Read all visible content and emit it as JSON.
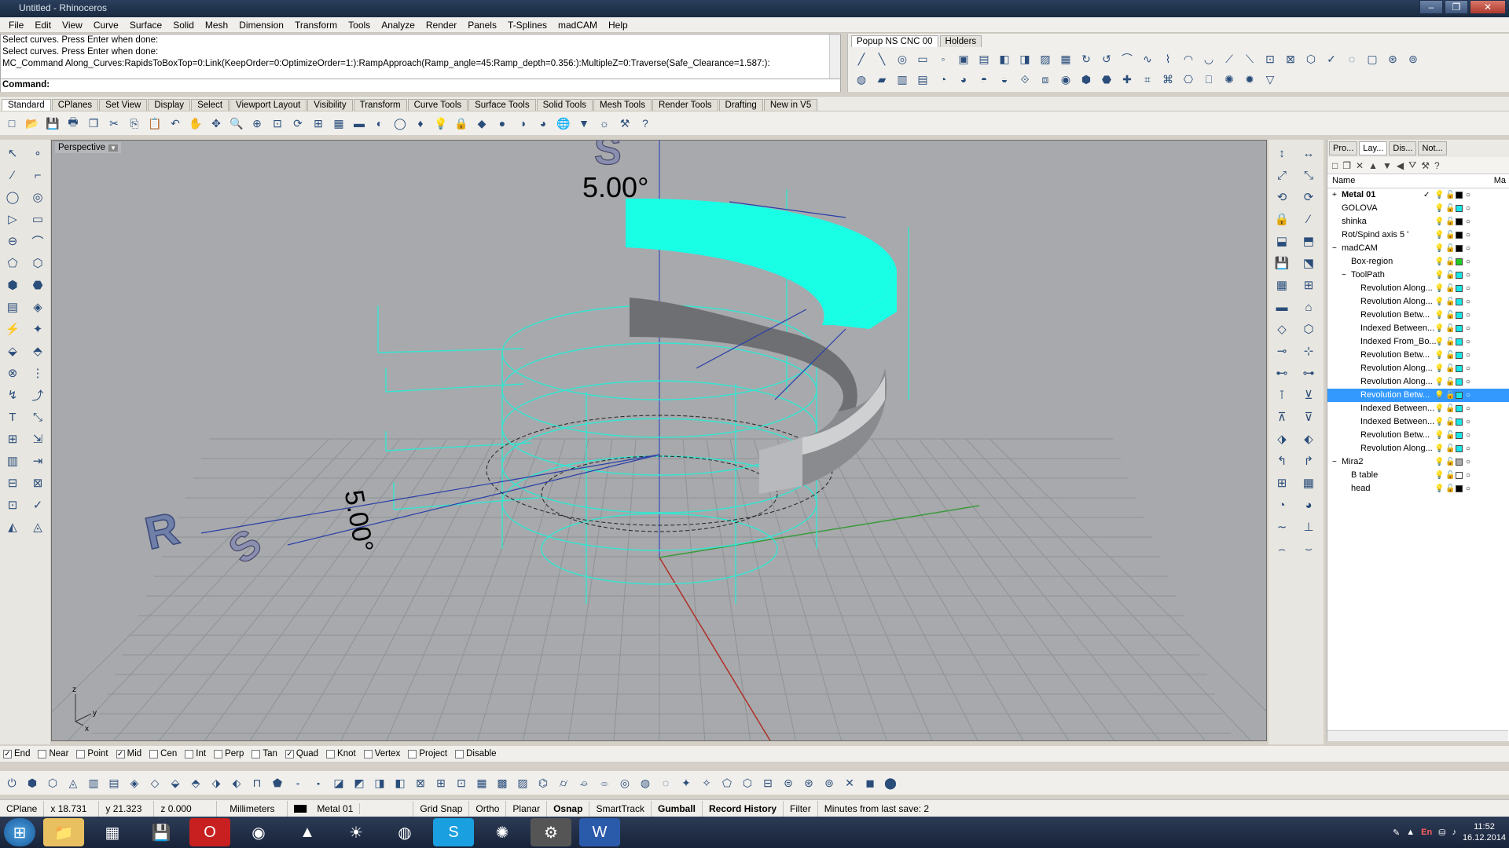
{
  "window": {
    "title": "Untitled - Rhinoceros",
    "buttons": [
      "–",
      "❐",
      "✕"
    ]
  },
  "menu": [
    "File",
    "Edit",
    "View",
    "Curve",
    "Surface",
    "Solid",
    "Mesh",
    "Dimension",
    "Transform",
    "Tools",
    "Analyze",
    "Render",
    "Panels",
    "T-Splines",
    "madCAM",
    "Help"
  ],
  "command": {
    "history": [
      "Select curves. Press Enter when done:",
      "Select curves. Press Enter when done:",
      "MC_Command Along_Curves:RapidsToBoxTop=0:Link(KeepOrder=0:OptimizeOrder=1:):RampApproach(Ramp_angle=45:Ramp_depth=0.356:):MultipleZ=0:Traverse(Safe_Clearance=1.587:):"
    ],
    "prompt": "Command:"
  },
  "popup_tabs": [
    "Popup NS CNC 00",
    "Holders"
  ],
  "toolbar_tabs": [
    "Standard",
    "CPlanes",
    "Set View",
    "Display",
    "Select",
    "Viewport Layout",
    "Visibility",
    "Transform",
    "Curve Tools",
    "Surface Tools",
    "Solid Tools",
    "Mesh Tools",
    "Render Tools",
    "Drafting",
    "New in V5"
  ],
  "viewport": {
    "label": "Perspective",
    "dim_top": "5.00°",
    "dim_bottom": "5.00°",
    "letter_r": "R",
    "letter_s": "S",
    "axis_x": "x",
    "axis_y": "y",
    "axis_z": "z",
    "colors": {
      "background": "#a7a9ac",
      "toolpath": "#33e6d2",
      "cyan_surface": "#19ffe6",
      "x_axis": "#b0302a",
      "y_axis": "#3a9a3a"
    }
  },
  "layer_panel": {
    "tabs": [
      "Pro...",
      "Lay...",
      "Dis...",
      "Not..."
    ],
    "column_name": "Name",
    "column_mat": "Ma",
    "layers": [
      {
        "name": "Metal 01",
        "indent": 0,
        "expand": "+",
        "bold": true,
        "current": "✓",
        "color": "#000000"
      },
      {
        "name": "GOLOVA",
        "indent": 0,
        "expand": "",
        "color": "#19e6e6"
      },
      {
        "name": "shinka",
        "indent": 0,
        "expand": "",
        "color": "#000000"
      },
      {
        "name": "Rot/Spind  axis 5 '",
        "indent": 0,
        "expand": "",
        "color": "#000000"
      },
      {
        "name": "madCAM",
        "indent": 0,
        "expand": "−",
        "color": "#000000"
      },
      {
        "name": "Box-region",
        "indent": 1,
        "expand": "",
        "color": "#22cc22"
      },
      {
        "name": "ToolPath",
        "indent": 1,
        "expand": "−",
        "color": "#19e6e6"
      },
      {
        "name": "Revolution Along...",
        "indent": 2,
        "expand": "",
        "color": "#19e6e6"
      },
      {
        "name": "Revolution Along...",
        "indent": 2,
        "expand": "",
        "color": "#19e6e6"
      },
      {
        "name": "Revolution Betw...",
        "indent": 2,
        "expand": "",
        "color": "#19e6e6"
      },
      {
        "name": "Indexed Between...",
        "indent": 2,
        "expand": "",
        "color": "#19e6e6"
      },
      {
        "name": "Indexed From_Bo...",
        "indent": 2,
        "expand": "",
        "color": "#19e6e6"
      },
      {
        "name": "Revolution Betw...",
        "indent": 2,
        "expand": "",
        "color": "#19e6e6"
      },
      {
        "name": "Revolution Along...",
        "indent": 2,
        "expand": "",
        "color": "#19e6e6"
      },
      {
        "name": "Revolution Along...",
        "indent": 2,
        "expand": "",
        "color": "#19e6e6"
      },
      {
        "name": "Revolution Betw...",
        "indent": 2,
        "expand": "",
        "color": "#19e6e6",
        "selected": true
      },
      {
        "name": "Indexed Between...",
        "indent": 2,
        "expand": "",
        "color": "#19e6e6"
      },
      {
        "name": "Indexed Between...",
        "indent": 2,
        "expand": "",
        "color": "#19e6e6"
      },
      {
        "name": "Revolution Betw...",
        "indent": 2,
        "expand": "",
        "color": "#19e6e6"
      },
      {
        "name": "Revolution Along...",
        "indent": 2,
        "expand": "",
        "color": "#19e6e6"
      },
      {
        "name": "Mira2",
        "indent": 0,
        "expand": "−",
        "color": "#aaaaaa"
      },
      {
        "name": "B table",
        "indent": 1,
        "expand": "",
        "color": "#ffffff"
      },
      {
        "name": "head",
        "indent": 1,
        "expand": "",
        "color": "#000000"
      }
    ]
  },
  "osnaps": [
    {
      "label": "End",
      "checked": true
    },
    {
      "label": "Near",
      "checked": false
    },
    {
      "label": "Point",
      "checked": false
    },
    {
      "label": "Mid",
      "checked": true
    },
    {
      "label": "Cen",
      "checked": false
    },
    {
      "label": "Int",
      "checked": false
    },
    {
      "label": "Perp",
      "checked": false
    },
    {
      "label": "Tan",
      "checked": false
    },
    {
      "label": "Quad",
      "checked": true
    },
    {
      "label": "Knot",
      "checked": false
    },
    {
      "label": "Vertex",
      "checked": false
    },
    {
      "label": "Project",
      "checked": false
    },
    {
      "label": "Disable",
      "checked": false
    }
  ],
  "status": {
    "cplane": "CPlane",
    "x": "x 18.731",
    "y": "y 21.323",
    "z": "z 0.000",
    "units": "Millimeters",
    "layer": "Metal 01",
    "grid_snap": "Grid Snap",
    "ortho": "Ortho",
    "planar": "Planar",
    "osnap": "Osnap",
    "smarttrack": "SmartTrack",
    "gumball": "Gumball",
    "record_history": "Record History",
    "filter": "Filter",
    "save": "Minutes from last save: 2"
  },
  "taskbar": {
    "time": "11:52",
    "date": "16.12.2014",
    "lang": "En"
  }
}
